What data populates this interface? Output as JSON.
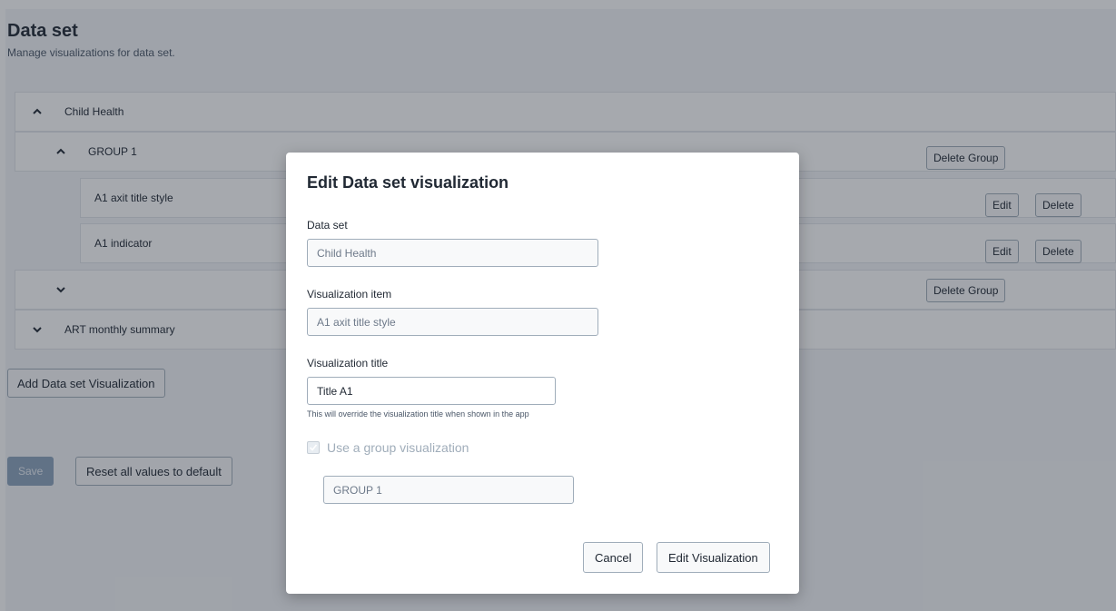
{
  "page": {
    "title": "Data set",
    "subtitle": "Manage visualizations for data set."
  },
  "tree": {
    "dataset1": {
      "label": "Child Health",
      "expanded": true,
      "icon": "chevron-up-icon"
    },
    "group1": {
      "label": "GROUP 1",
      "expanded": true,
      "icon": "chevron-up-icon",
      "delete_label": "Delete Group"
    },
    "items": [
      {
        "label": "A1 axit title style",
        "edit_label": "Edit",
        "delete_label": "Delete"
      },
      {
        "label": "A1 indicator",
        "edit_label": "Edit",
        "delete_label": "Delete"
      }
    ],
    "group2": {
      "label": "",
      "expanded": false,
      "icon": "chevron-down-icon",
      "delete_label": "Delete Group"
    },
    "dataset2": {
      "label": "ART monthly summary",
      "expanded": false,
      "icon": "chevron-down-icon"
    }
  },
  "actions": {
    "add_label": "Add Data set Visualization",
    "save_label": "Save",
    "reset_label": "Reset all values to default"
  },
  "modal": {
    "title": "Edit Data set visualization",
    "dataset_label": "Data set",
    "dataset_value": "Child Health",
    "item_label": "Visualization item",
    "item_value": "A1 axit title style",
    "vtitle_label": "Visualization title",
    "vtitle_value": "Title A1",
    "vtitle_help": "This will override the visualization title when shown in the app",
    "group_checkbox_label": "Use a group visualization",
    "group_checked": true,
    "group_value": "GROUP 1",
    "cancel_label": "Cancel",
    "submit_label": "Edit Visualization"
  },
  "colors": {
    "overlay": "#212934",
    "primary_disabled": "#8da3bd",
    "border": "#a0adba"
  }
}
